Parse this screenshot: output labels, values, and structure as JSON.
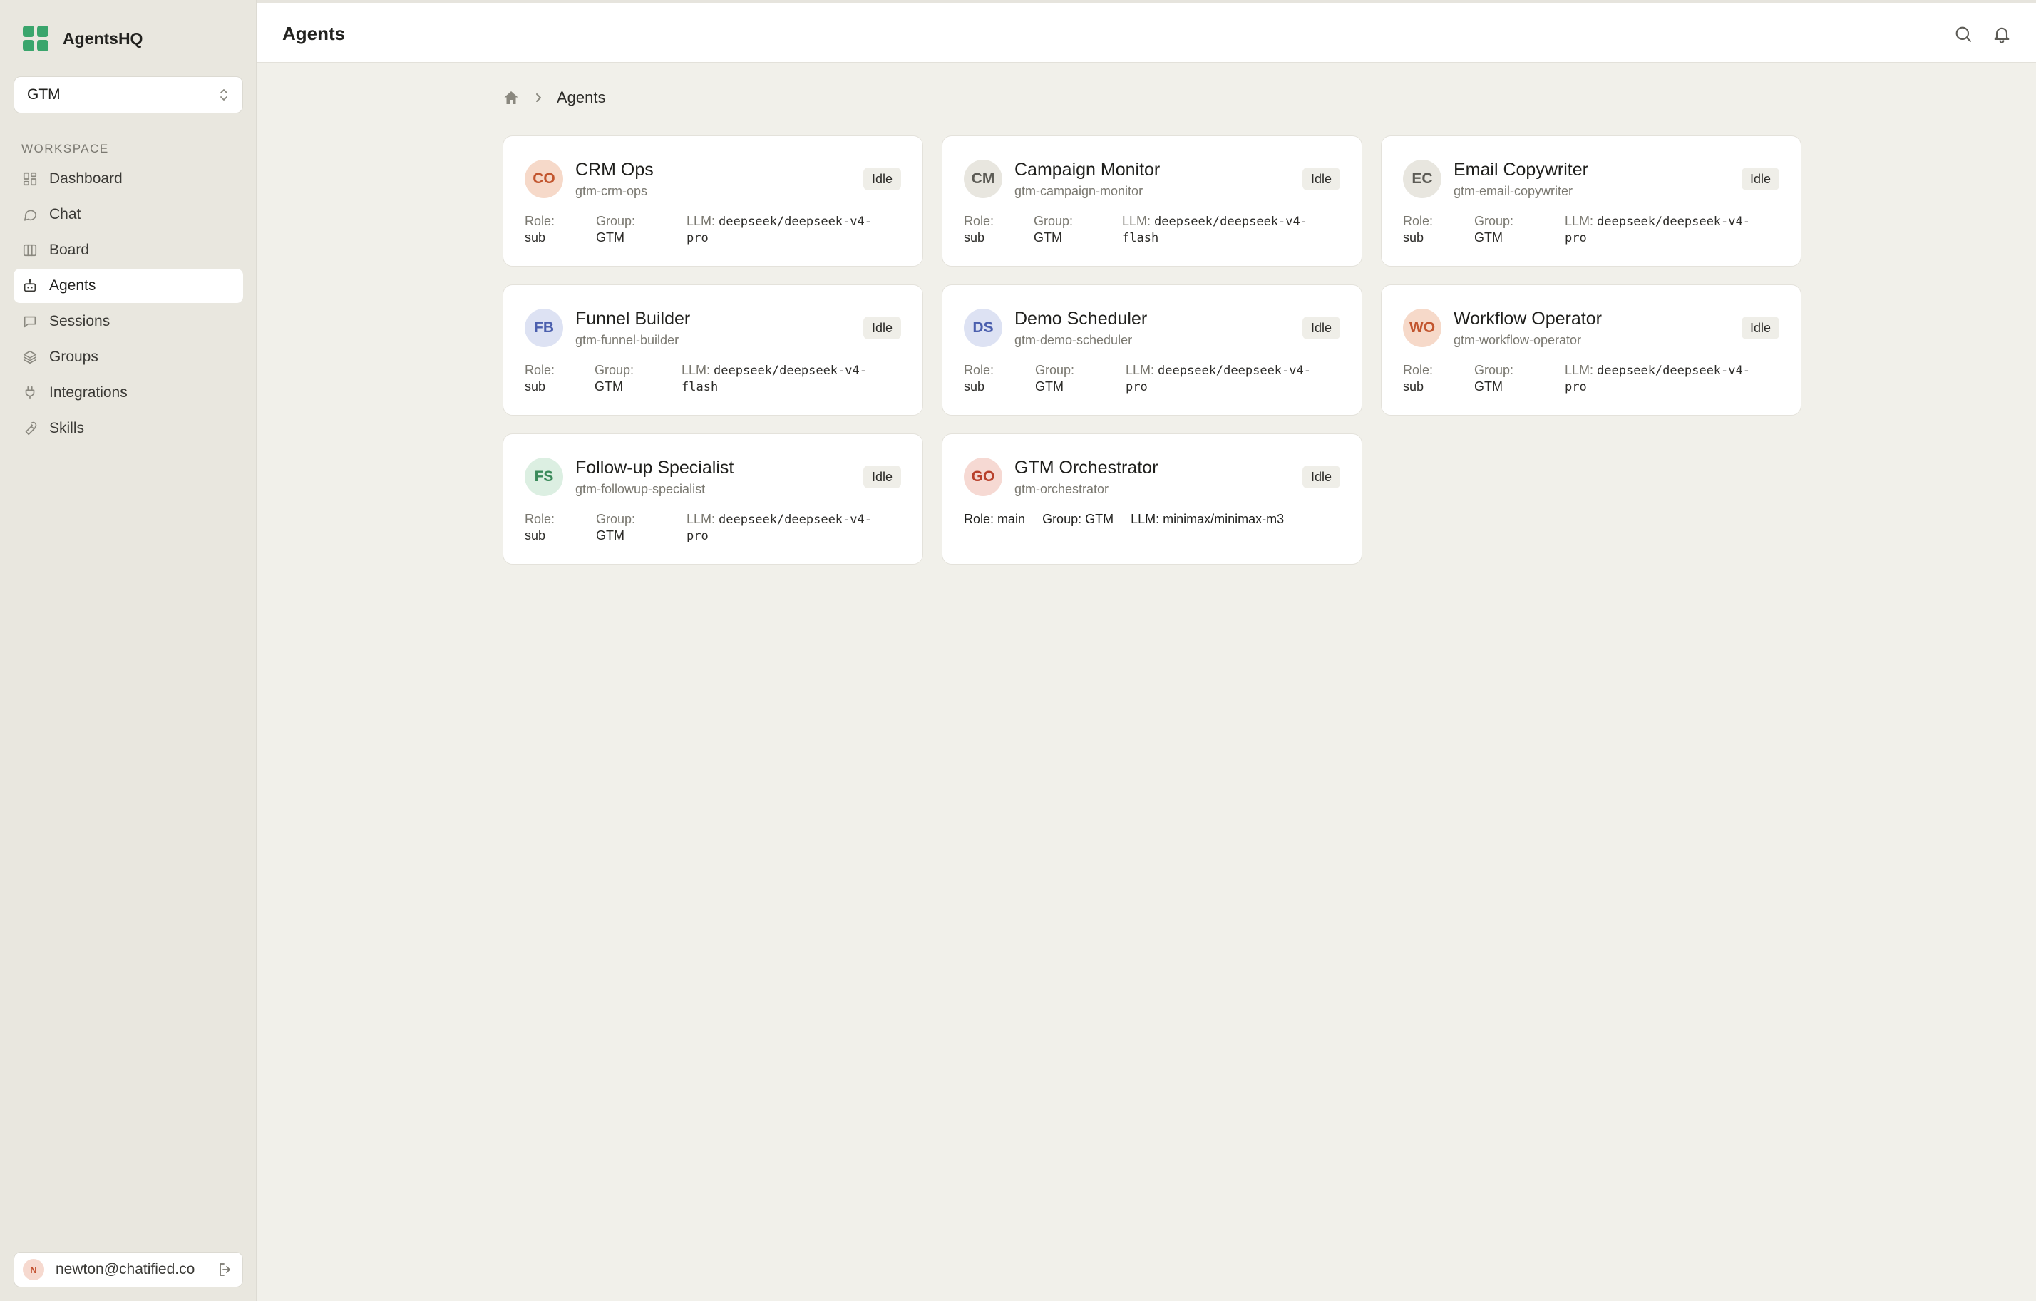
{
  "app": {
    "name": "AgentsHQ"
  },
  "workspace_selector": {
    "value": "GTM"
  },
  "sidebar": {
    "section_label": "Workspace",
    "items": [
      {
        "label": "Dashboard",
        "icon": "dashboard-icon"
      },
      {
        "label": "Chat",
        "icon": "chat-icon"
      },
      {
        "label": "Board",
        "icon": "board-icon"
      },
      {
        "label": "Agents",
        "icon": "bot-icon",
        "active": true
      },
      {
        "label": "Sessions",
        "icon": "sessions-icon"
      },
      {
        "label": "Groups",
        "icon": "layers-icon"
      },
      {
        "label": "Integrations",
        "icon": "plug-icon"
      },
      {
        "label": "Skills",
        "icon": "wrench-icon"
      }
    ]
  },
  "user": {
    "initial": "N",
    "email": "newton@chatified.co"
  },
  "header": {
    "title": "Agents"
  },
  "breadcrumb": {
    "current": "Agents"
  },
  "labels": {
    "role": "Role:",
    "group": "Group:",
    "llm": "LLM:"
  },
  "colors": {
    "brand": "#3aa56c",
    "active_bg": "#ffffff",
    "background": "#f1f0ea",
    "sidebar_bg": "#e9e7df"
  },
  "agents": [
    {
      "initials": "CO",
      "name": "CRM Ops",
      "slug": "gtm-crm-ops",
      "status": "Idle",
      "role": "sub",
      "group": "GTM",
      "llm_line1": "deepseek/deepseek-v4-",
      "llm_line2": "pro",
      "avatar_bg": "#f6d9c9",
      "avatar_fg": "#c2552e"
    },
    {
      "initials": "CM",
      "name": "Campaign Monitor",
      "slug": "gtm-campaign-monitor",
      "status": "Idle",
      "role": "sub",
      "group": "GTM",
      "llm_line1": "deepseek/deepseek-v4-",
      "llm_line2": "flash",
      "avatar_bg": "#e8e6df",
      "avatar_fg": "#5c5b55"
    },
    {
      "initials": "EC",
      "name": "Email Copywriter",
      "slug": "gtm-email-copywriter",
      "status": "Idle",
      "role": "sub",
      "group": "GTM",
      "llm_line1": "deepseek/deepseek-v4-",
      "llm_line2": "pro",
      "avatar_bg": "#e8e6df",
      "avatar_fg": "#5c5b55"
    },
    {
      "initials": "FB",
      "name": "Funnel Builder",
      "slug": "gtm-funnel-builder",
      "status": "Idle",
      "role": "sub",
      "group": "GTM",
      "llm_line1": "deepseek/deepseek-v4-",
      "llm_line2": "flash",
      "avatar_bg": "#dde2f3",
      "avatar_fg": "#4b5fae"
    },
    {
      "initials": "DS",
      "name": "Demo Scheduler",
      "slug": "gtm-demo-scheduler",
      "status": "Idle",
      "role": "sub",
      "group": "GTM",
      "llm_line1": "deepseek/deepseek-v4-",
      "llm_line2": "pro",
      "avatar_bg": "#dde2f3",
      "avatar_fg": "#4b5fae"
    },
    {
      "initials": "WO",
      "name": "Workflow Operator",
      "slug": "gtm-workflow-operator",
      "status": "Idle",
      "role": "sub",
      "group": "GTM",
      "llm_line1": "deepseek/deepseek-v4-",
      "llm_line2": "pro",
      "avatar_bg": "#f6d9c9",
      "avatar_fg": "#c2552e"
    },
    {
      "initials": "FS",
      "name": "Follow-up Specialist",
      "slug": "gtm-followup-specialist",
      "status": "Idle",
      "role": "sub",
      "group": "GTM",
      "llm_line1": "deepseek/deepseek-v4-",
      "llm_line2": "pro",
      "avatar_bg": "#dcefe2",
      "avatar_fg": "#3a8a5a"
    },
    {
      "initials": "GO",
      "name": "GTM Orchestrator",
      "slug": "gtm-orchestrator",
      "status": "Idle",
      "role": "main",
      "group": "GTM",
      "llm_line1": "minimax/minimax-m3",
      "llm_line2": "",
      "avatar_bg": "#f6d9d3",
      "avatar_fg": "#b8402b"
    }
  ]
}
